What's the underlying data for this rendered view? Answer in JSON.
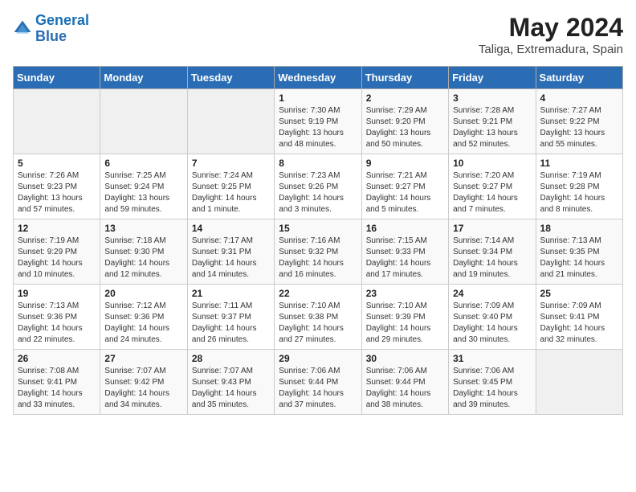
{
  "header": {
    "logo_line1": "General",
    "logo_line2": "Blue",
    "title": "May 2024",
    "subtitle": "Taliga, Extremadura, Spain"
  },
  "days_of_week": [
    "Sunday",
    "Monday",
    "Tuesday",
    "Wednesday",
    "Thursday",
    "Friday",
    "Saturday"
  ],
  "weeks": [
    [
      {
        "num": "",
        "info": ""
      },
      {
        "num": "",
        "info": ""
      },
      {
        "num": "",
        "info": ""
      },
      {
        "num": "1",
        "info": "Sunrise: 7:30 AM\nSunset: 9:19 PM\nDaylight: 13 hours\nand 48 minutes."
      },
      {
        "num": "2",
        "info": "Sunrise: 7:29 AM\nSunset: 9:20 PM\nDaylight: 13 hours\nand 50 minutes."
      },
      {
        "num": "3",
        "info": "Sunrise: 7:28 AM\nSunset: 9:21 PM\nDaylight: 13 hours\nand 52 minutes."
      },
      {
        "num": "4",
        "info": "Sunrise: 7:27 AM\nSunset: 9:22 PM\nDaylight: 13 hours\nand 55 minutes."
      }
    ],
    [
      {
        "num": "5",
        "info": "Sunrise: 7:26 AM\nSunset: 9:23 PM\nDaylight: 13 hours\nand 57 minutes."
      },
      {
        "num": "6",
        "info": "Sunrise: 7:25 AM\nSunset: 9:24 PM\nDaylight: 13 hours\nand 59 minutes."
      },
      {
        "num": "7",
        "info": "Sunrise: 7:24 AM\nSunset: 9:25 PM\nDaylight: 14 hours\nand 1 minute."
      },
      {
        "num": "8",
        "info": "Sunrise: 7:23 AM\nSunset: 9:26 PM\nDaylight: 14 hours\nand 3 minutes."
      },
      {
        "num": "9",
        "info": "Sunrise: 7:21 AM\nSunset: 9:27 PM\nDaylight: 14 hours\nand 5 minutes."
      },
      {
        "num": "10",
        "info": "Sunrise: 7:20 AM\nSunset: 9:27 PM\nDaylight: 14 hours\nand 7 minutes."
      },
      {
        "num": "11",
        "info": "Sunrise: 7:19 AM\nSunset: 9:28 PM\nDaylight: 14 hours\nand 8 minutes."
      }
    ],
    [
      {
        "num": "12",
        "info": "Sunrise: 7:19 AM\nSunset: 9:29 PM\nDaylight: 14 hours\nand 10 minutes."
      },
      {
        "num": "13",
        "info": "Sunrise: 7:18 AM\nSunset: 9:30 PM\nDaylight: 14 hours\nand 12 minutes."
      },
      {
        "num": "14",
        "info": "Sunrise: 7:17 AM\nSunset: 9:31 PM\nDaylight: 14 hours\nand 14 minutes."
      },
      {
        "num": "15",
        "info": "Sunrise: 7:16 AM\nSunset: 9:32 PM\nDaylight: 14 hours\nand 16 minutes."
      },
      {
        "num": "16",
        "info": "Sunrise: 7:15 AM\nSunset: 9:33 PM\nDaylight: 14 hours\nand 17 minutes."
      },
      {
        "num": "17",
        "info": "Sunrise: 7:14 AM\nSunset: 9:34 PM\nDaylight: 14 hours\nand 19 minutes."
      },
      {
        "num": "18",
        "info": "Sunrise: 7:13 AM\nSunset: 9:35 PM\nDaylight: 14 hours\nand 21 minutes."
      }
    ],
    [
      {
        "num": "19",
        "info": "Sunrise: 7:13 AM\nSunset: 9:36 PM\nDaylight: 14 hours\nand 22 minutes."
      },
      {
        "num": "20",
        "info": "Sunrise: 7:12 AM\nSunset: 9:36 PM\nDaylight: 14 hours\nand 24 minutes."
      },
      {
        "num": "21",
        "info": "Sunrise: 7:11 AM\nSunset: 9:37 PM\nDaylight: 14 hours\nand 26 minutes."
      },
      {
        "num": "22",
        "info": "Sunrise: 7:10 AM\nSunset: 9:38 PM\nDaylight: 14 hours\nand 27 minutes."
      },
      {
        "num": "23",
        "info": "Sunrise: 7:10 AM\nSunset: 9:39 PM\nDaylight: 14 hours\nand 29 minutes."
      },
      {
        "num": "24",
        "info": "Sunrise: 7:09 AM\nSunset: 9:40 PM\nDaylight: 14 hours\nand 30 minutes."
      },
      {
        "num": "25",
        "info": "Sunrise: 7:09 AM\nSunset: 9:41 PM\nDaylight: 14 hours\nand 32 minutes."
      }
    ],
    [
      {
        "num": "26",
        "info": "Sunrise: 7:08 AM\nSunset: 9:41 PM\nDaylight: 14 hours\nand 33 minutes."
      },
      {
        "num": "27",
        "info": "Sunrise: 7:07 AM\nSunset: 9:42 PM\nDaylight: 14 hours\nand 34 minutes."
      },
      {
        "num": "28",
        "info": "Sunrise: 7:07 AM\nSunset: 9:43 PM\nDaylight: 14 hours\nand 35 minutes."
      },
      {
        "num": "29",
        "info": "Sunrise: 7:06 AM\nSunset: 9:44 PM\nDaylight: 14 hours\nand 37 minutes."
      },
      {
        "num": "30",
        "info": "Sunrise: 7:06 AM\nSunset: 9:44 PM\nDaylight: 14 hours\nand 38 minutes."
      },
      {
        "num": "31",
        "info": "Sunrise: 7:06 AM\nSunset: 9:45 PM\nDaylight: 14 hours\nand 39 minutes."
      },
      {
        "num": "",
        "info": ""
      }
    ]
  ]
}
